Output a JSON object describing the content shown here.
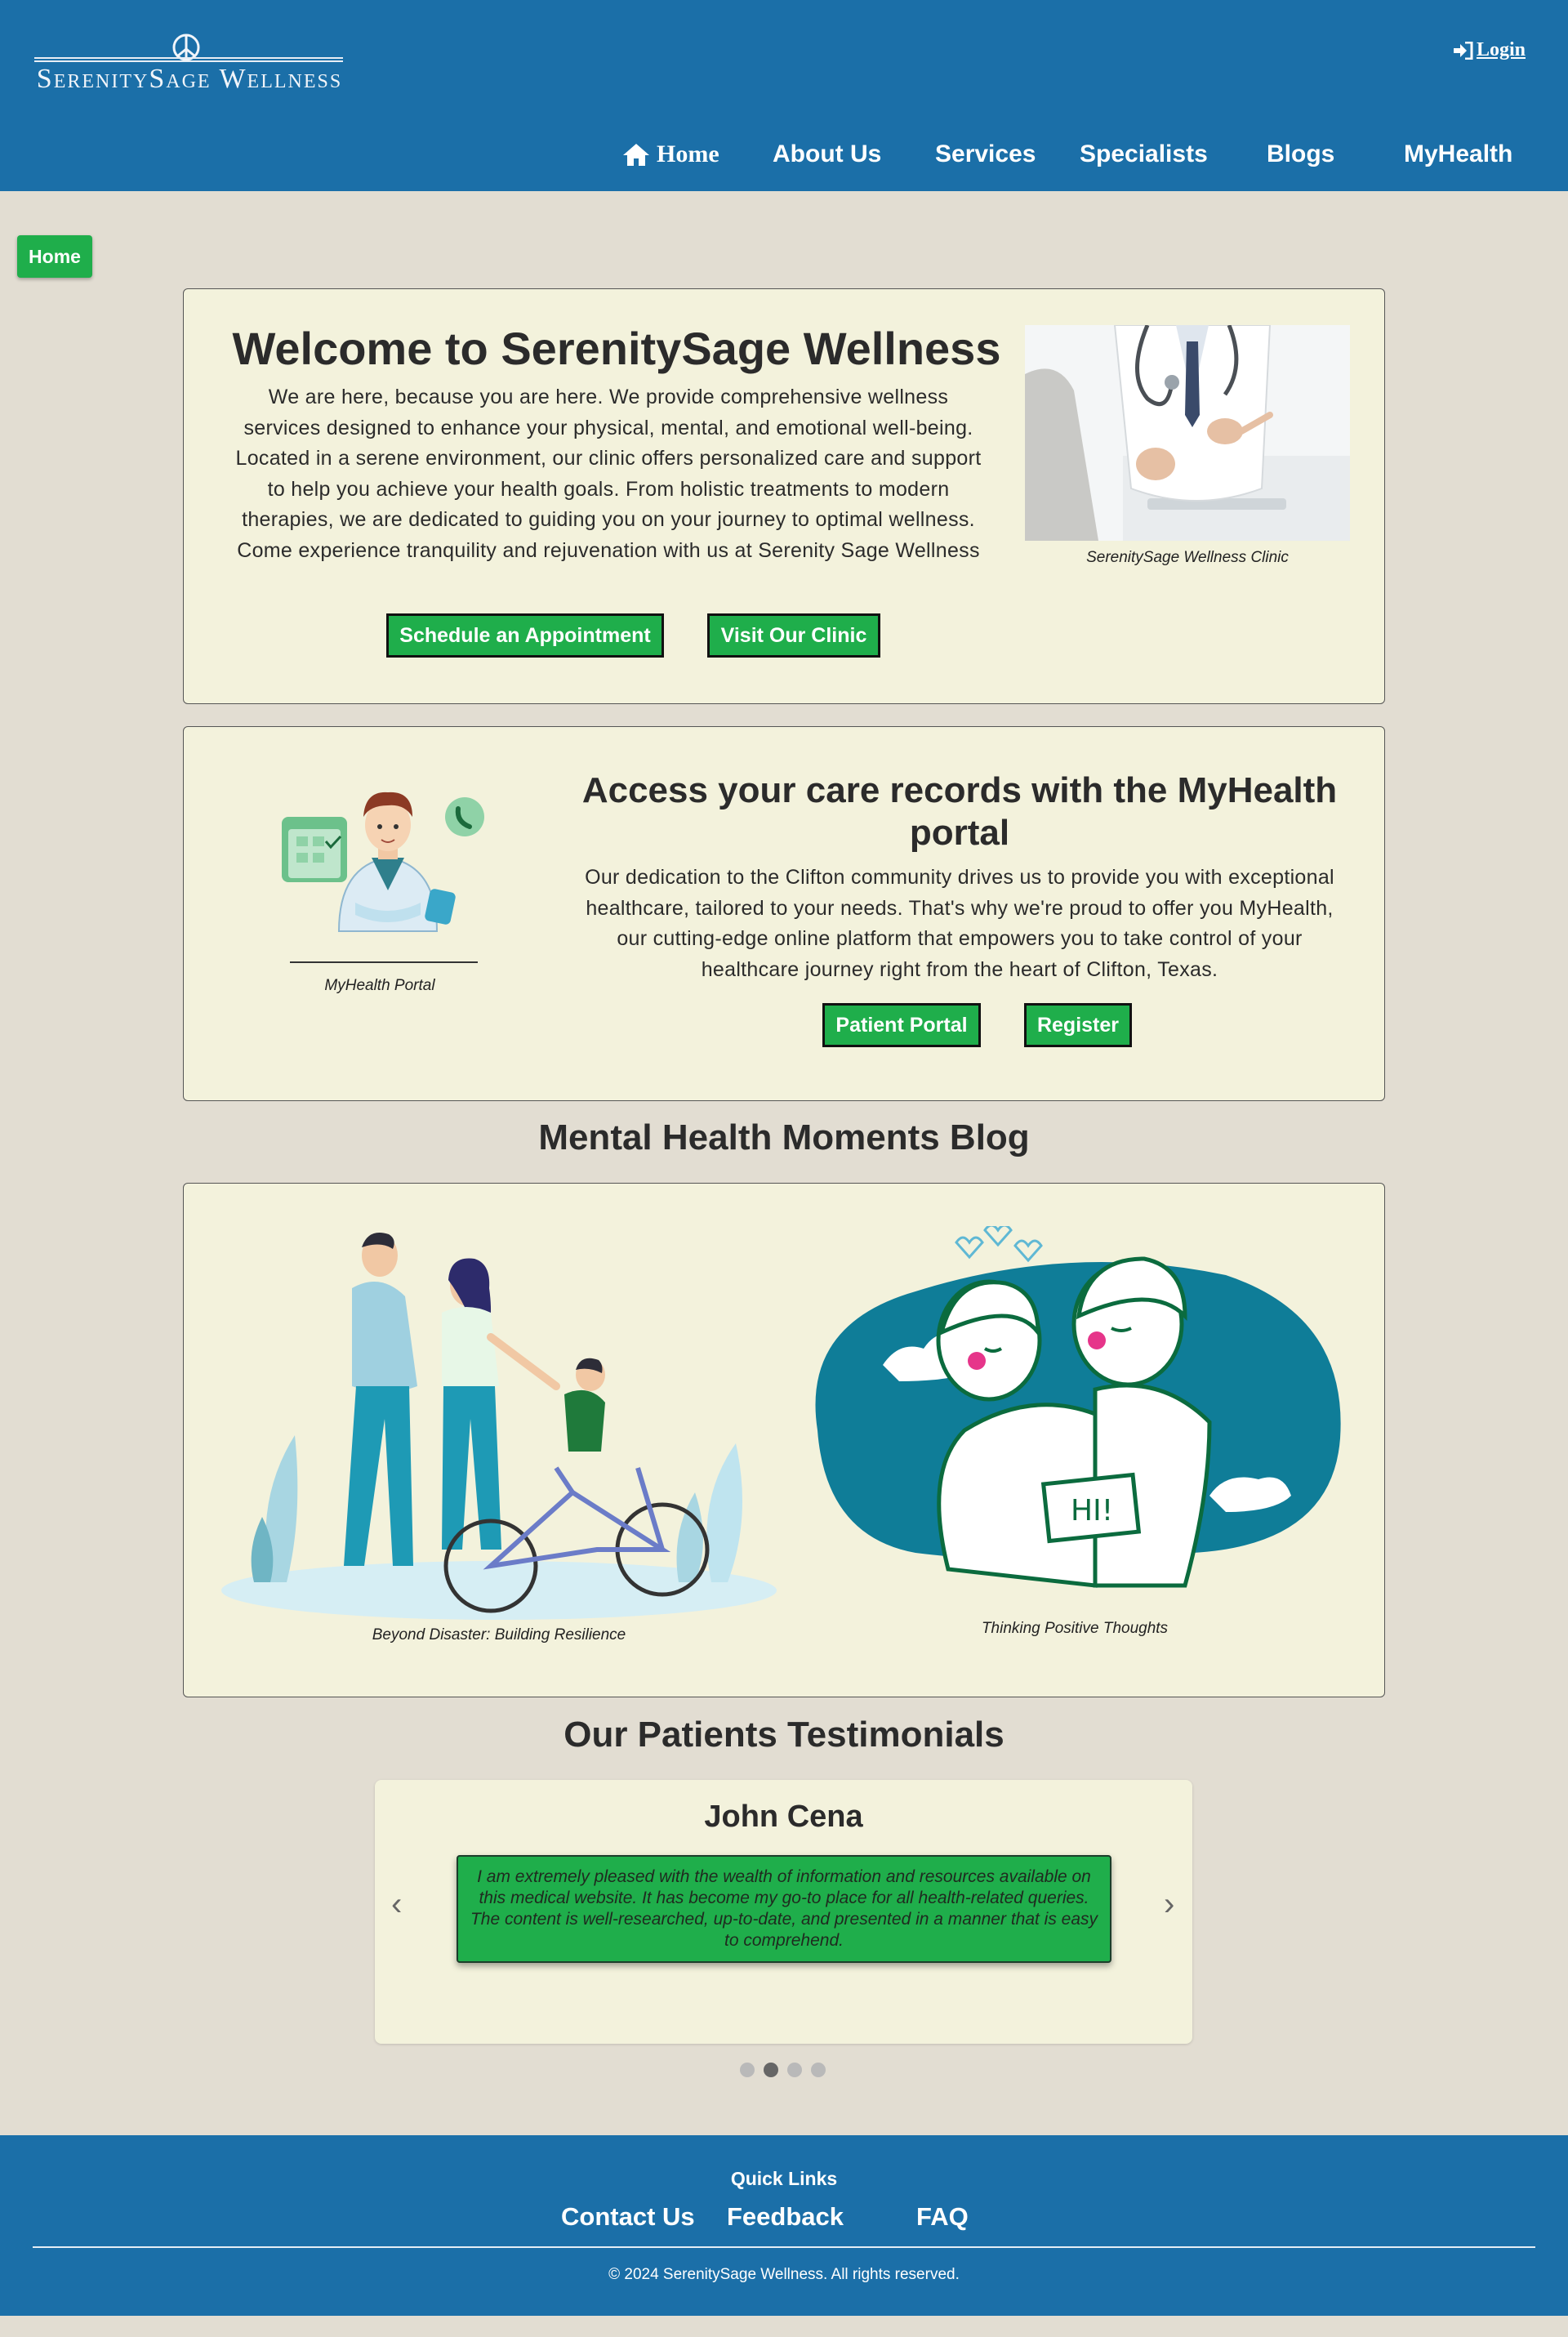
{
  "header": {
    "brand": "SerenitySage Wellness",
    "login_label": "Login",
    "nav": [
      "Home",
      "About Us",
      "Services",
      "Specialists",
      "Blogs",
      "MyHealth"
    ]
  },
  "breadcrumb": "Home",
  "welcome": {
    "title": "Welcome to SerenitySage Wellness",
    "text": "We are here, because you are here. We provide comprehensive wellness services designed to enhance your physical, mental, and emotional well-being. Located in a serene environment, our clinic offers personalized care and support to help you achieve your health goals. From holistic treatments to modern therapies, we are dedicated to guiding you on your journey to optimal wellness. Come experience tranquility and rejuvenation with us at Serenity Sage Wellness",
    "buttons": [
      "Schedule an Appointment",
      "Visit Our Clinic"
    ],
    "image_caption": "SerenitySage Wellness Clinic"
  },
  "portal": {
    "title": "Access your care records with the MyHealth portal",
    "text": "Our dedication to the Clifton community drives us to provide you with exceptional healthcare, tailored to your needs. That's why we're proud to offer you MyHealth, our cutting-edge online platform that empowers you to take control of your healthcare journey right from the heart of Clifton, Texas.",
    "buttons": [
      "Patient Portal",
      "Register"
    ],
    "image_caption": "MyHealth Portal"
  },
  "blog": {
    "heading": "Mental Health Moments Blog",
    "posts": [
      {
        "caption": "Beyond Disaster: Building Resilience"
      },
      {
        "caption": "Thinking Positive Thoughts"
      }
    ]
  },
  "testimonials": {
    "heading": "Our Patients Testimonials",
    "name": "John Cena",
    "quote": "I am extremely pleased with the wealth of information and resources available on this medical website. It has become my go-to place for all health-related queries. The content is well-researched, up-to-date, and presented in a manner that is easy to comprehend.",
    "prev": "‹",
    "next": "›",
    "slide_count": 4,
    "active_slide": 2
  },
  "footer": {
    "quick_links_label": "Quick Links",
    "links": [
      "Contact Us",
      "Feedback",
      "FAQ"
    ],
    "copyright": "© 2024 SerenitySage Wellness. All rights reserved."
  },
  "colors": {
    "header_bg": "#1b6fa8",
    "page_bg": "#e2ddd2",
    "card_bg": "#f3f2dc",
    "button_green": "#1fae4b",
    "teal": "#0f7d98"
  }
}
